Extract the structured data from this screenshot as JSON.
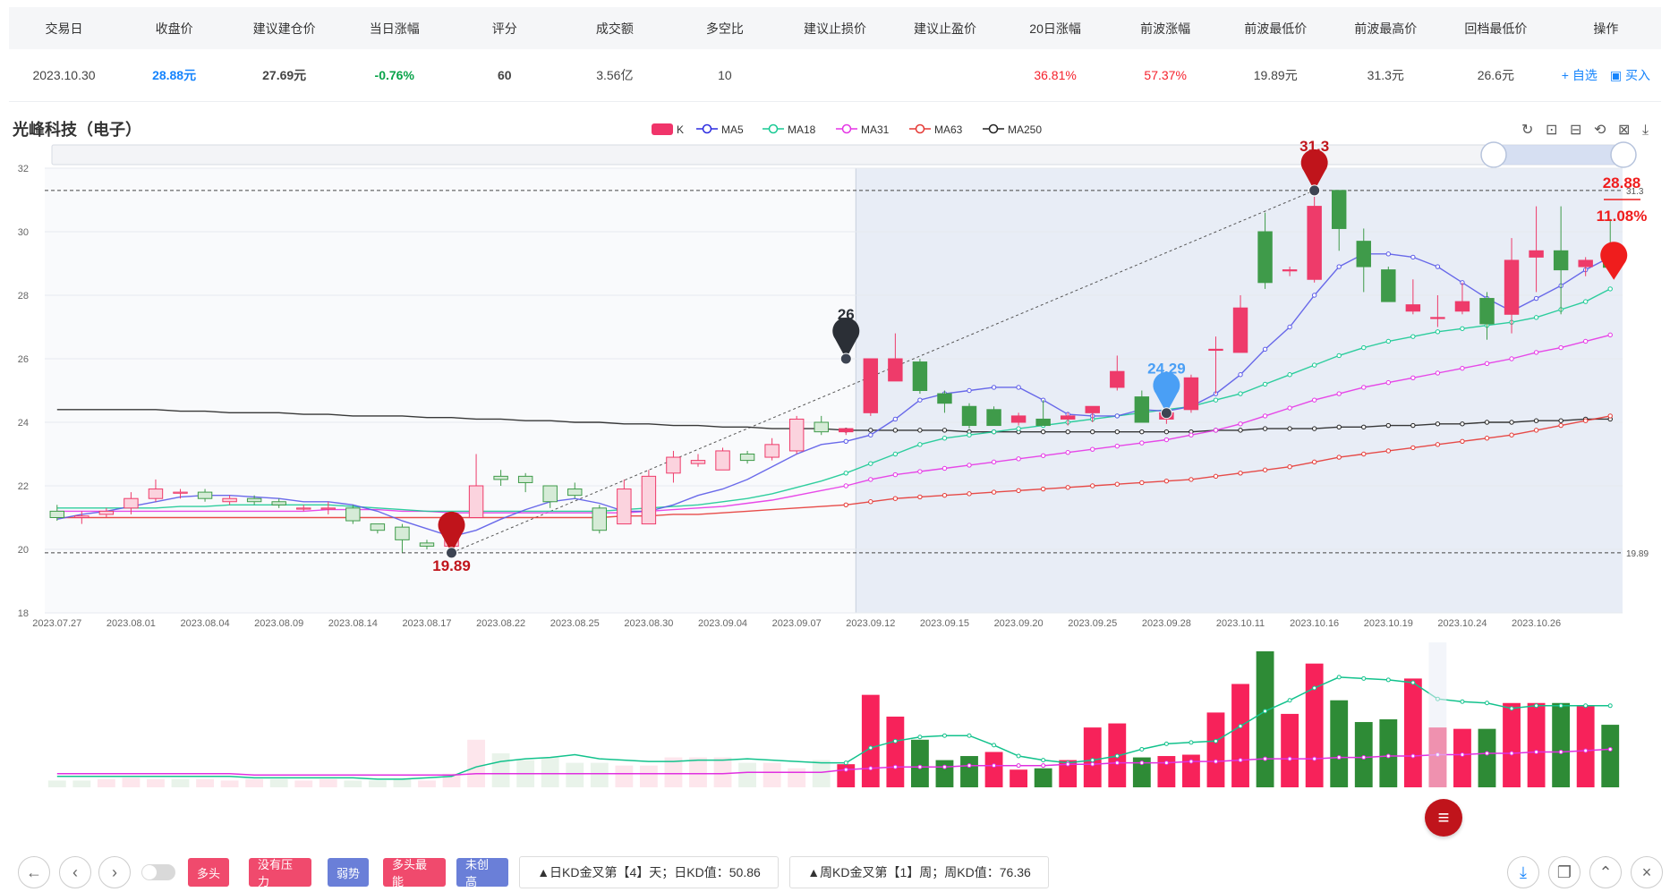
{
  "table": {
    "headers": [
      "交易日",
      "收盘价",
      "建议建仓价",
      "当日涨幅",
      "评分",
      "成交额",
      "多空比",
      "建议止损价",
      "建议止盈价",
      "20日涨幅",
      "前波涨幅",
      "前波最低价",
      "前波最高价",
      "回档最低价",
      "操作"
    ],
    "row": {
      "date": "2023.10.30",
      "close": "28.88元",
      "build_price": "27.69元",
      "change": "-0.76%",
      "score": "60",
      "turnover": "3.56亿",
      "ratio": "10",
      "stop_loss": "",
      "take_profit": "",
      "gain20": "36.81%",
      "prev_gain": "57.37%",
      "prev_low": "19.89元",
      "prev_high": "31.3元",
      "pullback_low": "26.6元",
      "op_watch": "+ 自选",
      "op_buy": "▣ 买入"
    }
  },
  "stock_title": "光峰科技（电子）",
  "legend": [
    {
      "name": "K",
      "color": "#f0346a"
    },
    {
      "name": "MA5",
      "color": "#2b2be0"
    },
    {
      "name": "MA18",
      "color": "#18c993"
    },
    {
      "name": "MA31",
      "color": "#e535e5"
    },
    {
      "name": "MA63",
      "color": "#e53935"
    },
    {
      "name": "MA250",
      "color": "#222222"
    }
  ],
  "toolbar_icons": [
    "refresh-icon",
    "zoom-area-icon",
    "zoom-reset-icon",
    "restore-icon",
    "select-icon",
    "download-icon"
  ],
  "chart_data": {
    "type": "candlestick",
    "ylim": [
      18,
      32
    ],
    "yticks": [
      18,
      20,
      22,
      24,
      26,
      28,
      30,
      32
    ],
    "xtick_labels": [
      "2023.07.27",
      "2023.08.01",
      "2023.08.04",
      "2023.08.09",
      "2023.08.14",
      "2023.08.17",
      "2023.08.22",
      "2023.08.25",
      "2023.08.30",
      "2023.09.04",
      "2023.09.07",
      "2023.09.12",
      "2023.09.15",
      "2023.09.20",
      "2023.09.25",
      "2023.09.28",
      "2023.10.11",
      "2023.10.16",
      "2023.10.19",
      "2023.10.24",
      "2023.10.26"
    ],
    "xtick_index": [
      0,
      3,
      6,
      9,
      12,
      15,
      18,
      21,
      24,
      27,
      30,
      33,
      36,
      39,
      42,
      45,
      48,
      51,
      54,
      57,
      60
    ],
    "candles": [
      [
        21.2,
        21.0,
        21.4,
        20.9
      ],
      [
        21.0,
        21.05,
        21.2,
        20.8
      ],
      [
        21.1,
        21.2,
        21.3,
        21.0
      ],
      [
        21.3,
        21.6,
        21.8,
        21.1
      ],
      [
        21.6,
        21.9,
        22.2,
        21.5
      ],
      [
        21.8,
        21.8,
        21.9,
        21.6
      ],
      [
        21.8,
        21.6,
        21.9,
        21.5
      ],
      [
        21.5,
        21.6,
        21.7,
        21.4
      ],
      [
        21.6,
        21.5,
        21.7,
        21.4
      ],
      [
        21.5,
        21.4,
        21.6,
        21.3
      ],
      [
        21.3,
        21.3,
        21.4,
        21.2
      ],
      [
        21.3,
        21.3,
        21.5,
        21.1
      ],
      [
        21.3,
        20.9,
        21.4,
        20.8
      ],
      [
        20.8,
        20.6,
        20.8,
        20.5
      ],
      [
        20.7,
        20.3,
        20.8,
        19.9
      ],
      [
        20.2,
        20.1,
        20.3,
        20.0
      ],
      [
        20.1,
        20.5,
        20.8,
        19.89
      ],
      [
        21.0,
        22.0,
        23.0,
        21.0
      ],
      [
        22.3,
        22.2,
        22.5,
        22.0
      ],
      [
        22.3,
        22.1,
        22.4,
        21.8
      ],
      [
        22.0,
        21.5,
        22.0,
        21.3
      ],
      [
        21.9,
        21.7,
        22.1,
        21.6
      ],
      [
        21.3,
        20.6,
        21.4,
        20.5
      ],
      [
        20.8,
        21.9,
        22.2,
        20.8
      ],
      [
        20.8,
        22.3,
        22.5,
        20.8
      ],
      [
        22.4,
        22.9,
        23.1,
        22.1
      ],
      [
        22.7,
        22.8,
        23.0,
        22.6
      ],
      [
        22.5,
        23.1,
        23.2,
        22.5
      ],
      [
        23.0,
        22.8,
        23.1,
        22.7
      ],
      [
        22.9,
        23.3,
        23.5,
        22.8
      ],
      [
        23.1,
        24.1,
        24.2,
        23.0
      ],
      [
        24.0,
        23.7,
        24.2,
        23.6
      ],
      [
        23.7,
        23.8,
        23.8,
        23.6
      ],
      [
        24.3,
        26.0,
        26.0,
        24.2
      ],
      [
        25.3,
        26.0,
        26.8,
        25.3
      ],
      [
        25.9,
        25.0,
        26.0,
        24.9
      ],
      [
        24.9,
        24.6,
        25.0,
        24.3
      ],
      [
        24.5,
        23.9,
        24.6,
        23.8
      ],
      [
        24.4,
        23.9,
        24.5,
        23.9
      ],
      [
        24.0,
        24.2,
        24.3,
        23.9
      ],
      [
        24.1,
        23.9,
        24.7,
        23.9
      ],
      [
        24.1,
        24.2,
        24.3,
        23.9
      ],
      [
        24.3,
        24.5,
        24.5,
        24.0
      ],
      [
        25.1,
        25.6,
        26.1,
        25.0
      ],
      [
        24.8,
        24.0,
        25.0,
        24.0
      ],
      [
        24.1,
        24.3,
        24.6,
        23.95
      ],
      [
        24.4,
        25.4,
        25.5,
        24.3
      ],
      [
        26.3,
        26.3,
        26.7,
        24.9
      ],
      [
        26.2,
        27.6,
        28.0,
        26.2
      ],
      [
        30.0,
        28.4,
        30.6,
        28.2
      ],
      [
        28.8,
        28.8,
        28.9,
        28.6
      ],
      [
        28.5,
        30.8,
        31.1,
        28.4
      ],
      [
        31.3,
        30.1,
        31.3,
        29.4
      ],
      [
        29.7,
        28.9,
        30.1,
        28.1
      ],
      [
        28.8,
        27.8,
        28.9,
        27.8
      ],
      [
        27.5,
        27.7,
        28.5,
        27.4
      ],
      [
        27.3,
        27.3,
        28.0,
        27.0
      ],
      [
        27.5,
        27.8,
        28.4,
        27.4
      ],
      [
        27.9,
        27.1,
        28.1,
        26.6
      ],
      [
        27.4,
        29.1,
        29.8,
        26.8
      ],
      [
        29.2,
        29.4,
        30.8,
        28.1
      ],
      [
        29.4,
        28.8,
        30.8,
        27.4
      ],
      [
        28.9,
        29.1,
        29.2,
        28.6
      ],
      [
        29.3,
        28.88,
        30.4,
        28.8
      ]
    ],
    "ma5": [
      20.95,
      21.1,
      21.2,
      21.35,
      21.5,
      21.65,
      21.7,
      21.7,
      21.65,
      21.6,
      21.5,
      21.5,
      21.4,
      21.2,
      20.9,
      20.65,
      20.4,
      20.6,
      20.95,
      21.25,
      21.5,
      21.6,
      21.45,
      21.2,
      21.2,
      21.4,
      21.7,
      21.9,
      22.2,
      22.6,
      23.0,
      23.3,
      23.4,
      23.6,
      24.1,
      24.7,
      24.9,
      25.0,
      25.1,
      25.1,
      24.7,
      24.25,
      24.2,
      24.2,
      24.4,
      24.35,
      24.5,
      24.9,
      25.5,
      26.3,
      27.0,
      28.0,
      28.9,
      29.3,
      29.3,
      29.2,
      28.9,
      28.4,
      27.9,
      27.5,
      27.9,
      28.3,
      28.8,
      29.2
    ],
    "ma18": [
      21.3,
      21.3,
      21.3,
      21.3,
      21.3,
      21.35,
      21.35,
      21.4,
      21.4,
      21.4,
      21.4,
      21.4,
      21.35,
      21.3,
      21.25,
      21.2,
      21.2,
      21.2,
      21.2,
      21.2,
      21.2,
      21.2,
      21.2,
      21.25,
      21.3,
      21.35,
      21.4,
      21.5,
      21.6,
      21.75,
      21.95,
      22.15,
      22.4,
      22.7,
      23.0,
      23.3,
      23.5,
      23.6,
      23.7,
      23.8,
      23.9,
      24.0,
      24.1,
      24.2,
      24.3,
      24.4,
      24.5,
      24.7,
      24.9,
      25.2,
      25.5,
      25.8,
      26.1,
      26.35,
      26.55,
      26.7,
      26.85,
      26.95,
      27.05,
      27.15,
      27.3,
      27.55,
      27.8,
      28.2
    ],
    "ma31": [
      21.2,
      21.2,
      21.2,
      21.2,
      21.2,
      21.2,
      21.2,
      21.2,
      21.2,
      21.2,
      21.2,
      21.25,
      21.25,
      21.25,
      21.2,
      21.2,
      21.15,
      21.15,
      21.15,
      21.15,
      21.15,
      21.15,
      21.15,
      21.15,
      21.2,
      21.25,
      21.3,
      21.35,
      21.45,
      21.55,
      21.7,
      21.85,
      22.0,
      22.2,
      22.35,
      22.45,
      22.55,
      22.65,
      22.75,
      22.85,
      22.95,
      23.05,
      23.15,
      23.25,
      23.35,
      23.45,
      23.6,
      23.75,
      23.95,
      24.2,
      24.45,
      24.7,
      24.9,
      25.1,
      25.25,
      25.4,
      25.55,
      25.7,
      25.85,
      26.0,
      26.2,
      26.35,
      26.55,
      26.75
    ],
    "ma63": [
      21.0,
      21.0,
      21.0,
      21.0,
      21.0,
      21.0,
      21.0,
      21.0,
      21.0,
      21.0,
      21.0,
      21.0,
      21.0,
      21.0,
      21.0,
      21.0,
      21.0,
      21.0,
      21.0,
      21.0,
      21.0,
      21.0,
      21.0,
      21.05,
      21.05,
      21.1,
      21.1,
      21.15,
      21.2,
      21.25,
      21.3,
      21.35,
      21.4,
      21.5,
      21.6,
      21.65,
      21.7,
      21.75,
      21.8,
      21.85,
      21.9,
      21.95,
      22.0,
      22.05,
      22.1,
      22.15,
      22.2,
      22.3,
      22.4,
      22.5,
      22.6,
      22.75,
      22.9,
      23.0,
      23.1,
      23.2,
      23.3,
      23.4,
      23.5,
      23.6,
      23.75,
      23.9,
      24.05,
      24.2
    ],
    "ma250": [
      24.4,
      24.4,
      24.4,
      24.4,
      24.4,
      24.35,
      24.35,
      24.3,
      24.3,
      24.3,
      24.25,
      24.25,
      24.2,
      24.2,
      24.2,
      24.15,
      24.15,
      24.1,
      24.1,
      24.05,
      24.05,
      24.0,
      24.0,
      23.95,
      23.95,
      23.9,
      23.9,
      23.85,
      23.85,
      23.8,
      23.8,
      23.8,
      23.75,
      23.75,
      23.75,
      23.75,
      23.75,
      23.7,
      23.7,
      23.7,
      23.7,
      23.7,
      23.7,
      23.7,
      23.7,
      23.7,
      23.7,
      23.75,
      23.75,
      23.8,
      23.8,
      23.8,
      23.85,
      23.85,
      23.9,
      23.9,
      23.95,
      23.95,
      24.0,
      24.0,
      24.05,
      24.05,
      24.1,
      24.1
    ],
    "hlines": [
      {
        "value": 31.3,
        "label": "31.3"
      },
      {
        "value": 19.89,
        "label": "19.89"
      }
    ],
    "trend_line": [
      [
        16,
        19.89
      ],
      [
        51,
        31.3
      ]
    ],
    "highlight_start_index": 32,
    "markers": [
      {
        "index": 16,
        "value": 19.89,
        "label": "19.89",
        "color": "#c0141b",
        "label_pos": "below"
      },
      {
        "index": 32,
        "value": 26.0,
        "label": "26",
        "color": "#2b2f36",
        "label_pos": "above"
      },
      {
        "index": 45,
        "value": 24.29,
        "label": "24.29",
        "color": "#4a9ff5",
        "label_pos": "above"
      },
      {
        "index": 51,
        "value": 31.3,
        "label": "31.3",
        "color": "#c0141b",
        "label_pos": "above"
      }
    ],
    "current_price_label": "28.88",
    "current_pct_label": "11.08%",
    "volume": {
      "values": [
        0.05,
        0.05,
        0.06,
        0.07,
        0.06,
        0.06,
        0.06,
        0.05,
        0.06,
        0.06,
        0.05,
        0.06,
        0.05,
        0.05,
        0.06,
        0.05,
        0.1,
        0.35,
        0.25,
        0.2,
        0.22,
        0.18,
        0.18,
        0.16,
        0.16,
        0.22,
        0.22,
        0.22,
        0.18,
        0.18,
        0.14,
        0.2,
        0.17,
        0.68,
        0.52,
        0.35,
        0.2,
        0.23,
        0.26,
        0.13,
        0.14,
        0.2,
        0.44,
        0.47,
        0.22,
        0.23,
        0.24,
        0.55,
        0.76,
        1.0,
        0.54,
        0.91,
        0.64,
        0.48,
        0.5,
        0.8,
        0.44,
        0.43,
        0.43,
        0.62,
        0.62,
        0.62,
        0.6,
        0.46
      ],
      "up": [
        0,
        0,
        1,
        1,
        1,
        0,
        1,
        1,
        1,
        0,
        1,
        1,
        0,
        0,
        0,
        1,
        1,
        1,
        0,
        0,
        0,
        0,
        0,
        1,
        1,
        1,
        1,
        1,
        0,
        1,
        1,
        0,
        1,
        1,
        1,
        0,
        0,
        0,
        1,
        1,
        0,
        1,
        1,
        1,
        0,
        1,
        1,
        1,
        1,
        0,
        1,
        1,
        0,
        0,
        0,
        1,
        1,
        1,
        0,
        1,
        1,
        0,
        1,
        0
      ],
      "ma_a": [
        0.08,
        0.08,
        0.08,
        0.08,
        0.08,
        0.08,
        0.08,
        0.08,
        0.07,
        0.07,
        0.07,
        0.07,
        0.07,
        0.06,
        0.06,
        0.07,
        0.08,
        0.15,
        0.19,
        0.21,
        0.22,
        0.24,
        0.21,
        0.2,
        0.19,
        0.19,
        0.2,
        0.2,
        0.21,
        0.2,
        0.19,
        0.18,
        0.18,
        0.29,
        0.34,
        0.37,
        0.38,
        0.38,
        0.31,
        0.23,
        0.2,
        0.18,
        0.2,
        0.23,
        0.28,
        0.32,
        0.33,
        0.34,
        0.45,
        0.56,
        0.64,
        0.73,
        0.81,
        0.8,
        0.79,
        0.77,
        0.65,
        0.63,
        0.62,
        0.58,
        0.6,
        0.6,
        0.6,
        0.6
      ],
      "ma_b": [
        0.1,
        0.1,
        0.1,
        0.1,
        0.1,
        0.1,
        0.1,
        0.1,
        0.09,
        0.09,
        0.09,
        0.09,
        0.09,
        0.09,
        0.09,
        0.09,
        0.09,
        0.1,
        0.1,
        0.1,
        0.1,
        0.1,
        0.1,
        0.1,
        0.1,
        0.1,
        0.1,
        0.1,
        0.11,
        0.11,
        0.11,
        0.11,
        0.13,
        0.14,
        0.15,
        0.15,
        0.15,
        0.16,
        0.16,
        0.16,
        0.16,
        0.17,
        0.17,
        0.18,
        0.18,
        0.18,
        0.19,
        0.19,
        0.2,
        0.21,
        0.21,
        0.21,
        0.22,
        0.22,
        0.23,
        0.23,
        0.24,
        0.24,
        0.25,
        0.25,
        0.26,
        0.26,
        0.27,
        0.28
      ]
    }
  },
  "bottom": {
    "prev_icon": "arrow-left-icon",
    "tags": [
      "多头",
      "没有压力",
      "弱势",
      "多头最能",
      "未创高"
    ],
    "info1": "▲日KD金叉第【4】天；日KD值：50.86",
    "info2": "▲周KD金叉第【1】周；周KD值：76.36",
    "menu_icon": "≡"
  }
}
